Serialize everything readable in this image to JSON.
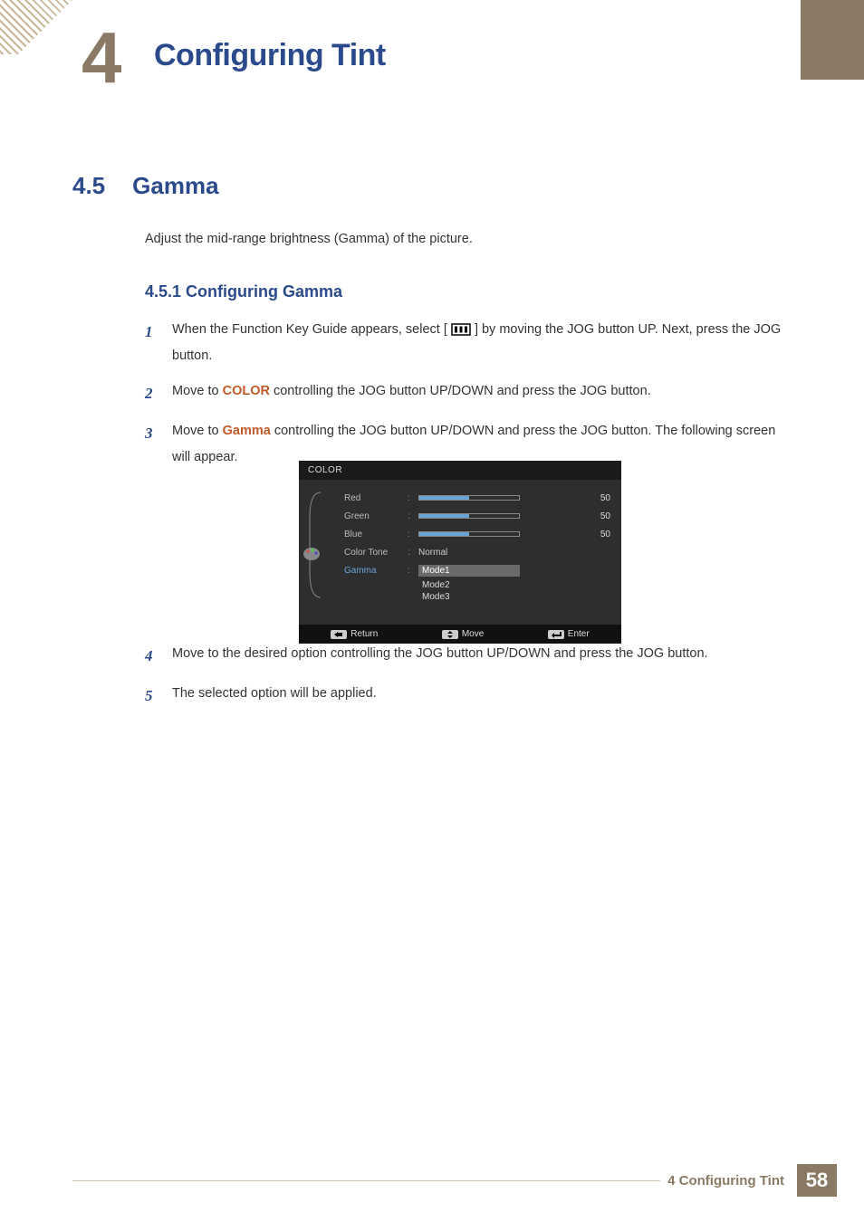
{
  "chapter": {
    "number": "4",
    "title": "Configuring Tint"
  },
  "section": {
    "number": "4.5",
    "title": "Gamma"
  },
  "intro": "Adjust the mid-range brightness (Gamma) of the picture.",
  "subsection": "4.5.1   Configuring Gamma",
  "steps": {
    "s1n": "1",
    "s1a": "When the Function Key Guide appears, select  [",
    "s1b": "]  by moving the JOG button UP. Next, press the JOG button.",
    "s2n": "2",
    "s2a": "Move to ",
    "s2h": "COLOR",
    "s2b": " controlling the JOG button UP/DOWN and press the JOG button.",
    "s3n": "3",
    "s3a": "Move to ",
    "s3h": "Gamma",
    "s3b": " controlling the JOG button UP/DOWN and press the JOG button. The following screen will appear.",
    "s4n": "4",
    "s4": "Move to the desired option controlling the JOG button UP/DOWN and press the JOG button.",
    "s5n": "5",
    "s5": "The selected option will be applied."
  },
  "osd": {
    "title": "COLOR",
    "red": {
      "label": "Red",
      "value": "50"
    },
    "green": {
      "label": "Green",
      "value": "50"
    },
    "blue": {
      "label": "Blue",
      "value": "50"
    },
    "colortone": {
      "label": "Color Tone",
      "value": "Normal"
    },
    "gamma": {
      "label": "Gamma",
      "mode1": "Mode1",
      "mode2": "Mode2",
      "mode3": "Mode3"
    },
    "footer": {
      "return": "Return",
      "move": "Move",
      "enter": "Enter"
    }
  },
  "footer": {
    "text": "4 Configuring Tint",
    "page": "58"
  }
}
